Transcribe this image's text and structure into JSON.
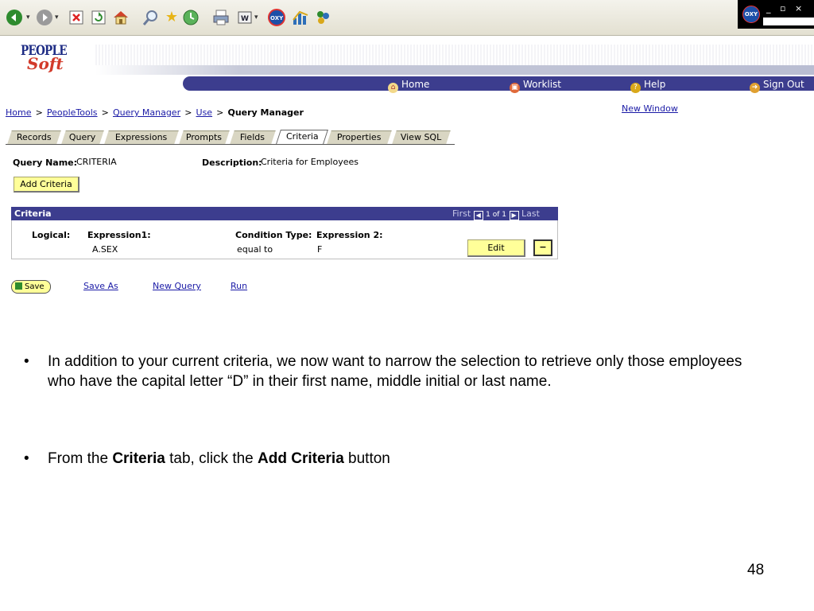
{
  "toolbar": {
    "icons": [
      "back-icon",
      "forward-icon",
      "stop-icon",
      "refresh-icon",
      "home-icon",
      "search-icon",
      "favorites-icon",
      "history-icon",
      "print-icon",
      "edit-icon",
      "oxy-icon",
      "chart-icon",
      "messenger-icon"
    ]
  },
  "window": {
    "controls": "_ ▫ ×",
    "brand": "OXY"
  },
  "header": {
    "logo_top": "PEOPLE",
    "logo_bottom": "Soft",
    "nav": {
      "home": "Home",
      "worklist": "Worklist",
      "help": "Help",
      "signout": "Sign Out"
    }
  },
  "breadcrumb": {
    "items": [
      "Home",
      "PeopleTools",
      "Query Manager",
      "Use"
    ],
    "sep": ">",
    "current": "Query Manager",
    "new_window": "New Window"
  },
  "tabs": [
    "Records",
    "Query",
    "Expressions",
    "Prompts",
    "Fields",
    "Criteria",
    "Properties",
    "View SQL"
  ],
  "active_tab": "Criteria",
  "query": {
    "name_label": "Query Name:",
    "name_value": "CRITERIA",
    "desc_label": "Description:",
    "desc_value": "Criteria for Employees",
    "add_criteria": "Add Criteria"
  },
  "criteria_grid": {
    "title": "Criteria",
    "nav_first": "First",
    "nav_count": "1 of 1",
    "nav_last": "Last",
    "columns": {
      "logical": "Logical:",
      "expr1": "Expression1:",
      "cond": "Condition Type:",
      "expr2": "Expression 2:"
    },
    "row": {
      "logical": "",
      "expr1": "A.SEX",
      "cond": "equal to",
      "expr2": "F"
    },
    "edit_label": "Edit",
    "delete_label": "−"
  },
  "actions": {
    "save": "Save",
    "save_as": "Save As",
    "new_query": "New Query",
    "run": "Run"
  },
  "notes": {
    "bullet1": "In addition to your current criteria, we now want to narrow the selection to retrieve only those employees who have the capital letter “D” in their first name, middle initial or last name.",
    "b2_pre": "From the ",
    "b2_bold1": "Criteria",
    "b2_mid": " tab, click the ",
    "b2_bold2": "Add Criteria",
    "b2_post": " button",
    "bullet_char": "•"
  },
  "page_number": "48",
  "colors": {
    "nav_bar": "#3c3d8e",
    "link": "#1a1aa6",
    "button_yellow": "#ffff99",
    "logo_red": "#d23a2a",
    "logo_blue": "#1f2d85"
  }
}
